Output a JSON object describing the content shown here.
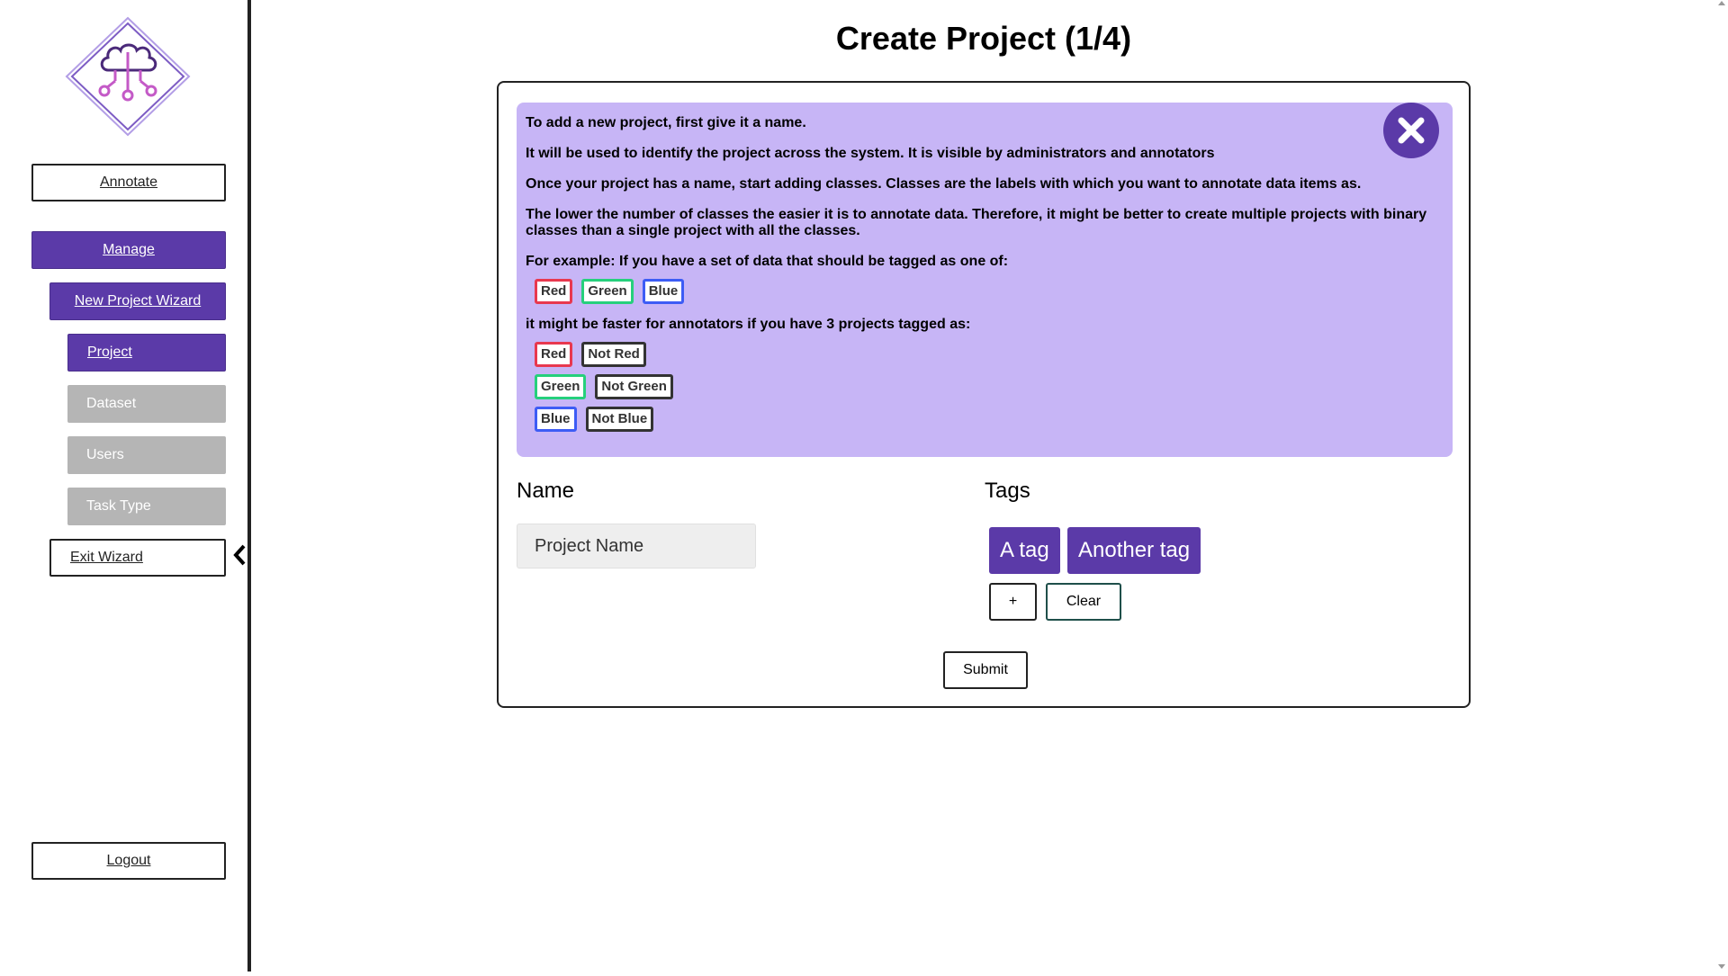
{
  "sidebar": {
    "annotate": "Annotate",
    "manage": "Manage",
    "new_project_wizard": "New Project Wizard",
    "steps": [
      "Project",
      "Dataset",
      "Users",
      "Task Type"
    ],
    "exit_wizard": "Exit Wizard",
    "logout": "Logout"
  },
  "page": {
    "title": "Create Project (1/4)"
  },
  "info": {
    "p1": "To add a new project, first give it a name.",
    "p2": "It will be used to identify the project across the system. It is visible by administrators and annotators",
    "p3": "Once your project has a name, start adding classes. Classes are the labels with which you want to annotate data items as.",
    "p4": "The lower the number of classes the easier it is to annotate data. Therefore, it might be better to create multiple projects with binary classes than a single project with all the classes.",
    "p5": "For example: If you have a set of data that should be tagged as one of:",
    "example_chips": [
      "Red",
      "Green",
      "Blue"
    ],
    "p6": "it might be faster for annotators if you have 3 projects tagged as:",
    "binary_rows": [
      [
        "Red",
        "Not Red"
      ],
      [
        "Green",
        "Not Green"
      ],
      [
        "Blue",
        "Not Blue"
      ]
    ]
  },
  "form": {
    "name_label": "Name",
    "name_placeholder": "Project Name",
    "tags_label": "Tags",
    "tags": [
      "A tag",
      "Another tag"
    ],
    "add_label": "+",
    "clear_label": "Clear",
    "submit_label": "Submit"
  },
  "colors": {
    "accent": "#5b3aa8",
    "info_bg": "#c7b5f6",
    "red": "#e8384f",
    "green": "#26d07c",
    "blue": "#3d5cf5",
    "disabled": "#b5b5b5"
  }
}
